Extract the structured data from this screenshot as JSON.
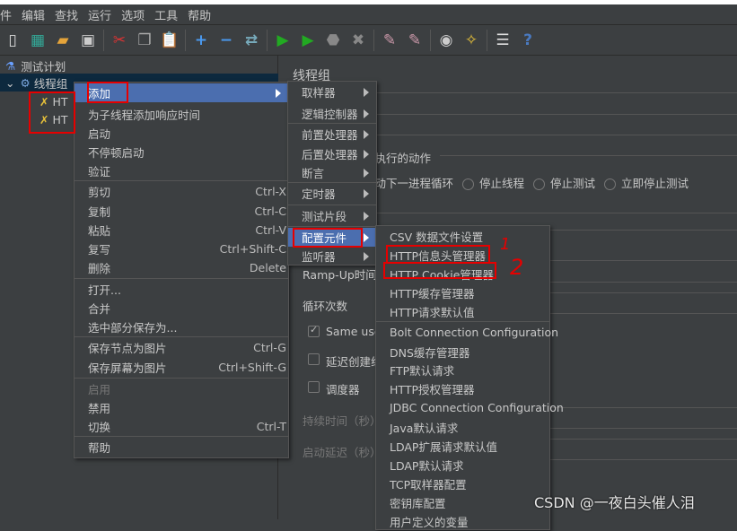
{
  "menubar": [
    "件",
    "编辑",
    "查找",
    "运行",
    "选项",
    "工具",
    "帮助"
  ],
  "toolbar_icons": [
    "new-icon",
    "templates-icon",
    "open-icon",
    "save-icon",
    "cut-icon",
    "copy-icon",
    "paste-icon",
    "expand-icon",
    "collapse-icon",
    "toggle-icon",
    "start-icon",
    "start-no-pause-icon",
    "stop-icon",
    "shutdown-icon",
    "clear-icon",
    "clear-all-icon",
    "search-icon",
    "reset-search-icon",
    "function-helper-icon",
    "help-icon"
  ],
  "tree": {
    "test_plan": "测试计划",
    "thread_group": "线程组",
    "child1": "HT",
    "child2": "HT"
  },
  "right_panel": {
    "title": "线程组",
    "action_label": "要执行的动作",
    "options": [
      "启动下一进程循环",
      "停止线程",
      "停止测试",
      "立即停止测试"
    ],
    "ramp_up": "Ramp-Up时间",
    "loops": "循环次数",
    "same_user": "Same user",
    "delay_create": "延迟创建线",
    "scheduler": "调度器",
    "duration": "持续时间（秒）",
    "startup_delay": "启动延迟（秒）"
  },
  "context_menu": [
    {
      "label": "添加",
      "submenu": true,
      "highlighted": true
    },
    {
      "label": "为子线程添加响应时间"
    },
    {
      "label": "启动"
    },
    {
      "label": "不停顿启动"
    },
    {
      "label": "验证"
    },
    {
      "label": "剪切",
      "shortcut": "Ctrl-X"
    },
    {
      "label": "复制",
      "shortcut": "Ctrl-C"
    },
    {
      "label": "粘贴",
      "shortcut": "Ctrl-V"
    },
    {
      "label": "复写",
      "shortcut": "Ctrl+Shift-C"
    },
    {
      "label": "删除",
      "shortcut": "Delete"
    },
    {
      "label": "打开..."
    },
    {
      "label": "合并"
    },
    {
      "label": "选中部分保存为..."
    },
    {
      "label": "保存节点为图片",
      "shortcut": "Ctrl-G"
    },
    {
      "label": "保存屏幕为图片",
      "shortcut": "Ctrl+Shift-G"
    },
    {
      "label": "启用",
      "disabled": true
    },
    {
      "label": "禁用"
    },
    {
      "label": "切换",
      "shortcut": "Ctrl-T"
    },
    {
      "label": "帮助"
    }
  ],
  "add_submenu": [
    {
      "label": "取样器"
    },
    {
      "label": "逻辑控制器"
    },
    {
      "label": "前置处理器"
    },
    {
      "label": "后置处理器"
    },
    {
      "label": "断言"
    },
    {
      "label": "定时器"
    },
    {
      "label": "测试片段"
    },
    {
      "label": "配置元件",
      "highlighted": true
    },
    {
      "label": "监听器"
    }
  ],
  "config_submenu": [
    "CSV 数据文件设置",
    "HTTP信息头管理器",
    "HTTP Cookie管理器",
    "HTTP缓存管理器",
    "HTTP请求默认值",
    "Bolt Connection Configuration",
    "DNS缓存管理器",
    "FTP默认请求",
    "HTTP授权管理器",
    "JDBC Connection Configuration",
    "Java默认请求",
    "LDAP扩展请求默认值",
    "LDAP默认请求",
    "TCP取样器配置",
    "密钥库配置",
    "用户定义的变量"
  ],
  "annotations": [
    "1",
    "2"
  ],
  "watermark": "CSDN @一夜白头催人泪",
  "colors": {
    "highlight": "#4b6eaf",
    "annotation": "#e60000",
    "background": "#3c3f41"
  }
}
